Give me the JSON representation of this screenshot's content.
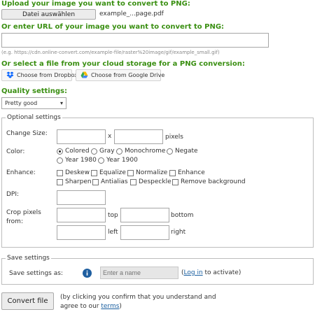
{
  "upload": {
    "heading": "Upload your image you want to convert to PNG:",
    "choose_button": "Datei auswählen",
    "file_name": "example_...page.pdf"
  },
  "url": {
    "heading": "Or enter URL of your image you want to convert to PNG:",
    "value": "",
    "hint": "(e.g. https://cdn.online-convert.com/example-file/raster%20image/gif/example_small.gif)"
  },
  "cloud": {
    "heading": "Or select a file from your cloud storage for a PNG conversion:",
    "dropbox_label": "Choose from Dropbox",
    "drive_label": "Choose from Google Drive"
  },
  "quality": {
    "heading": "Quality settings:",
    "selected": "Pretty good"
  },
  "optional": {
    "legend": "Optional settings",
    "change_size_label": "Change Size:",
    "times": "x",
    "pixels": "pixels",
    "color_label": "Color:",
    "color_options": [
      "Colored",
      "Gray",
      "Monochrome",
      "Negate",
      "Year 1980",
      "Year 1900"
    ],
    "color_selected": "Colored",
    "enhance_label": "Enhance:",
    "enhance_options": [
      "Deskew",
      "Equalize",
      "Normalize",
      "Enhance",
      "Sharpen",
      "Antialias",
      "Despeckle",
      "Remove background"
    ],
    "dpi_label": "DPI:",
    "crop_label_1": "Crop pixels",
    "crop_label_2": "from:",
    "crop_top": "top",
    "crop_bottom": "bottom",
    "crop_left": "left",
    "crop_right": "right"
  },
  "save": {
    "legend": "Save settings",
    "label": "Save settings as:",
    "placeholder": "Enter a name",
    "open_paren": "(",
    "login_link": "Log in",
    "after_link": " to activate)"
  },
  "convert": {
    "button": "Convert file",
    "note_line1": "(by clicking you confirm that you understand and",
    "note_line2_prefix": "agree to our ",
    "terms_link": "terms",
    "note_line2_suffix": ")"
  },
  "colors": {
    "heading_green": "#3a8f12",
    "link_blue": "#1a5fa0",
    "info_blue": "#1f5fa0"
  },
  "icons": [
    "dropbox-icon",
    "google-drive-icon",
    "chevron-down-icon",
    "info-icon"
  ]
}
